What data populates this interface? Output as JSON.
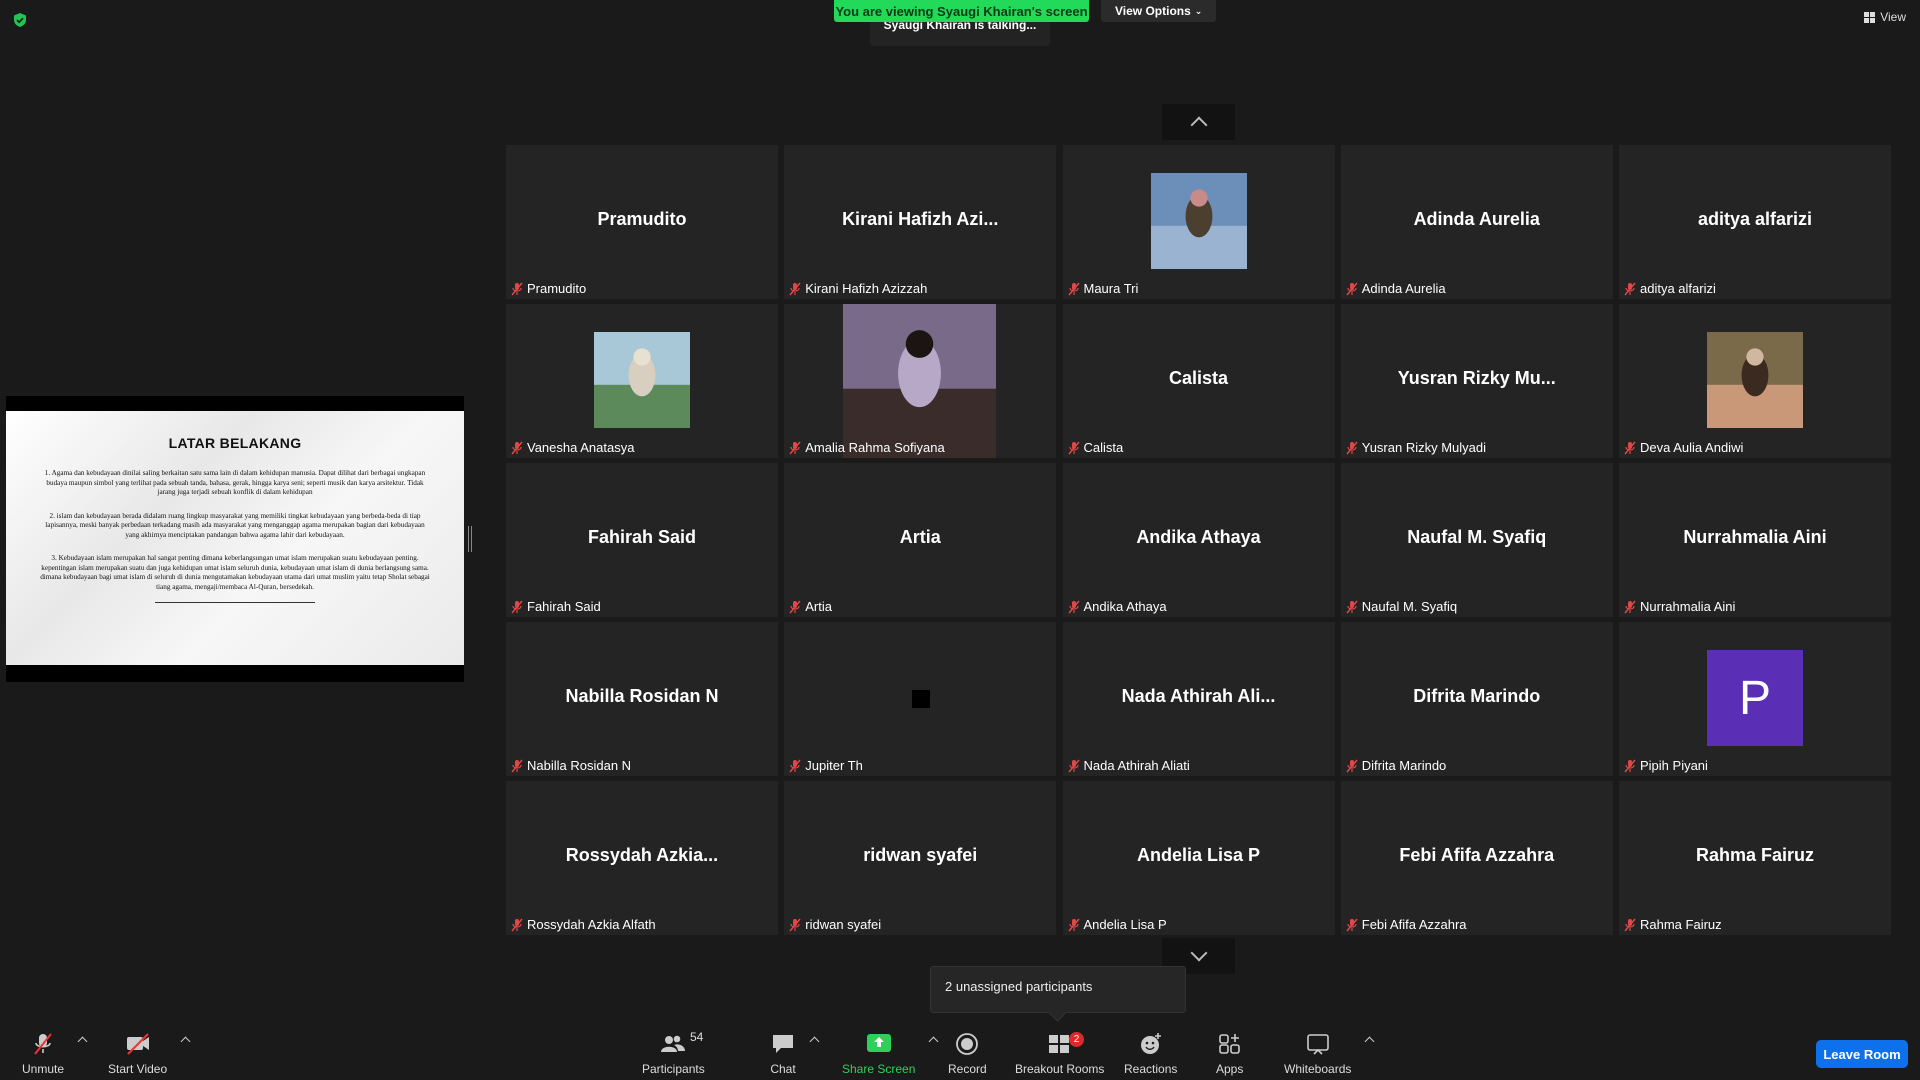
{
  "top": {
    "viewing_banner": "You are viewing Syaugi Khairan's screen",
    "view_options_label": "View Options",
    "talking_text": "Syaugi Khairan is talking...",
    "view_label": "View"
  },
  "slide": {
    "title": "LATAR BELAKANG",
    "p1": "1.   Agama dan kebudayaan dinilai saling berkaitan satu sama lain di dalam kehidupan manusia. Dapat dilihat dari berbagai ungkapan budaya maupun simbol yang terlihat pada sebuah tanda, bahasa, gerak, hingga karya seni; seperti musik dan karya arsitektur. Tidak jarang juga terjadi sebuah konflik di dalam kehidupan",
    "p2": "2. islam dan kebudayaan berada didalam ruang lingkup masyarakat yang memiliki tingkat kebudayaan yang berbeda-beda di tiap lapisannya, meski banyak perbedaan terkadang masih ada masyarakat yang menganggap agama merupakan bagian dari kebudayaan yang akhirnya menciptakan pandangan bahwa agama lahir dari kebudayaan.",
    "p3": "3.  Kebudayaan islam merupakan hal sangat penting dimana keberlangsungan umat islam merupakan suatu kebudayaan penting. kepentingan islam merupakan suatu dan juga kehidupan umat islam seluruh dunia, kebudayaan umat islam di dunia berlangsung sama. dimana kebudayaan bagi umat islam di seluruh di dunia mengutamakan kebudayaan utama dari umat muslim yaitu tetap Sholat sebagai tiang agama, mengaji/membaca Al-Quran, bersedekah."
  },
  "participants": [
    {
      "big": "Pramudito",
      "label": "Pramudito",
      "kind": "name"
    },
    {
      "big": "Kirani  Hafizh  Azi...",
      "label": "Kirani Hafizh Azizzah",
      "kind": "name"
    },
    {
      "big": "",
      "label": "Maura Tri",
      "kind": "photo"
    },
    {
      "big": "Adinda Aurelia",
      "label": "Adinda Aurelia",
      "kind": "name"
    },
    {
      "big": "aditya alfarizi",
      "label": "aditya alfarizi",
      "kind": "name"
    },
    {
      "big": "",
      "label": "Vanesha Anatasya",
      "kind": "photo"
    },
    {
      "big": "",
      "label": "Amalia Rahma Sofiyana",
      "kind": "video"
    },
    {
      "big": "Calista",
      "label": "Calista",
      "kind": "name"
    },
    {
      "big": "Yusran  Rizky  Mu...",
      "label": "Yusran Rizky Mulyadi",
      "kind": "name"
    },
    {
      "big": "",
      "label": "Deva Aulia Andiwi",
      "kind": "photo"
    },
    {
      "big": "Fahirah Said",
      "label": "Fahirah Said",
      "kind": "name"
    },
    {
      "big": "Artia",
      "label": "Artia",
      "kind": "name"
    },
    {
      "big": "Andika Athaya",
      "label": "Andika Athaya",
      "kind": "name"
    },
    {
      "big": "Naufal M. Syafiq",
      "label": "Naufal M. Syafiq",
      "kind": "name"
    },
    {
      "big": "Nurrahmalia Aini",
      "label": "Nurrahmalia Aini",
      "kind": "name"
    },
    {
      "big": "Nabilla Rosidan N",
      "label": "Nabilla Rosidan N",
      "kind": "name"
    },
    {
      "big": "",
      "label": "Jupiter Th",
      "kind": "square"
    },
    {
      "big": "Nada  Athirah  Ali...",
      "label": "Nada Athirah Aliati",
      "kind": "name"
    },
    {
      "big": "Difrita Marindo",
      "label": "Difrita Marindo",
      "kind": "name"
    },
    {
      "big": "P",
      "label": "Pipih Piyani",
      "kind": "avatar"
    },
    {
      "big": "Rossydah  Azkia...",
      "label": "Rossydah Azkia Alfath",
      "kind": "name"
    },
    {
      "big": "ridwan syafei",
      "label": "ridwan syafei",
      "kind": "name"
    },
    {
      "big": "Andelia Lisa P",
      "label": "Andelia Lisa P",
      "kind": "name"
    },
    {
      "big": "Febi Afifa Azzahra",
      "label": "Febi Afifa Azzahra",
      "kind": "name"
    },
    {
      "big": "Rahma Fairuz",
      "label": "Rahma Fairuz",
      "kind": "name"
    }
  ],
  "unassigned_text": "2 unassigned participants",
  "toolbar": {
    "unmute": "Unmute",
    "start_video": "Start Video",
    "participants": "Participants",
    "participants_count": "54",
    "chat": "Chat",
    "share_screen": "Share Screen",
    "record": "Record",
    "breakout_rooms": "Breakout Rooms",
    "breakout_badge": "2",
    "reactions": "Reactions",
    "apps": "Apps",
    "whiteboards": "Whiteboards",
    "leave_room": "Leave Room"
  },
  "colors": {
    "banner_green": "#23d959",
    "leave_blue": "#0e71eb",
    "avatar_purple": "#5b2fb5",
    "badge_red": "#e02828"
  }
}
